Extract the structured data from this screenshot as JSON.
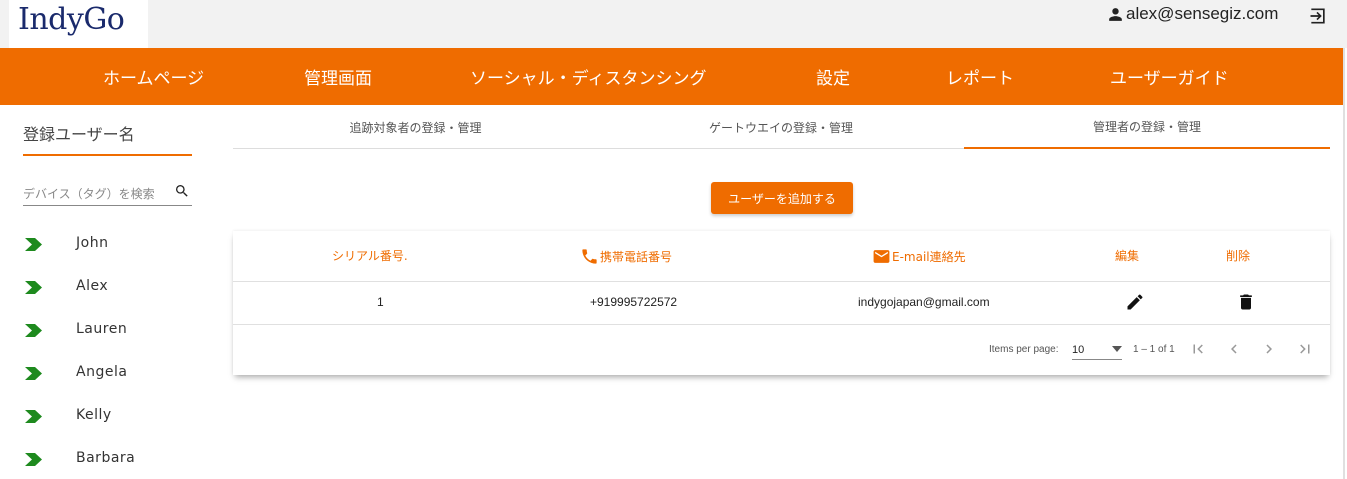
{
  "header": {
    "logo_text": "IndyGo",
    "user_email": "alex@sensegiz.com"
  },
  "nav": {
    "items": [
      {
        "label": "ホームページ"
      },
      {
        "label": "管理画面"
      },
      {
        "label": "ソーシャル・ディスタンシング"
      },
      {
        "label": "設定"
      },
      {
        "label": "レポート"
      },
      {
        "label": "ユーザーガイド"
      }
    ]
  },
  "sidebar": {
    "title": "登録ユーザー名",
    "search_placeholder": "デバイス（タグ）を検索",
    "users": [
      "John",
      "Alex",
      "Lauren",
      "Angela",
      "Kelly",
      "Barbara"
    ]
  },
  "tabs": [
    {
      "label": "追跡対象者の登録・管理",
      "active": false
    },
    {
      "label": "ゲートウエイの登録・管理",
      "active": false
    },
    {
      "label": "管理者の登録・管理",
      "active": true
    }
  ],
  "add_button_label": "ユーザーを追加する",
  "table": {
    "headers": {
      "serial": "シリアル番号.",
      "phone": "携帯電話番号",
      "email": "E-mail連絡先",
      "edit": "編集",
      "delete": "削除"
    },
    "rows": [
      {
        "serial": "1",
        "phone": "+919995722572",
        "email": "indygojapan@gmail.com"
      }
    ]
  },
  "pagination": {
    "items_per_page_label": "Items per page:",
    "page_size": "10",
    "range_label": "1 – 1 of 1"
  },
  "colors": {
    "accent": "#ef6c00",
    "sidebar_arrow": "#1e8a1e"
  }
}
